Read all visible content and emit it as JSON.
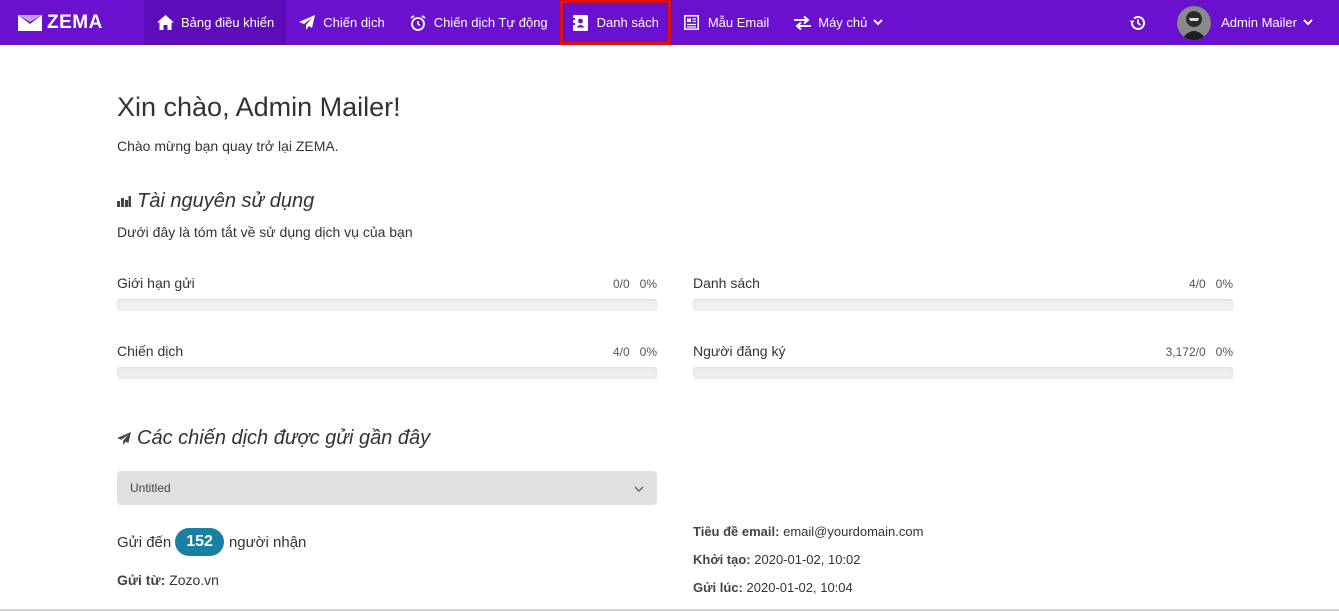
{
  "brand": {
    "name": "ZEMA"
  },
  "nav": {
    "items": [
      {
        "label": "Bảng điều khiển",
        "icon": "home-icon"
      },
      {
        "label": "Chiến dịch",
        "icon": "paper-plane-icon"
      },
      {
        "label": "Chiến dịch Tự động",
        "icon": "alarm-clock-icon"
      },
      {
        "label": "Danh sách",
        "icon": "address-book-icon"
      },
      {
        "label": "Mẫu Email",
        "icon": "newspaper-icon"
      },
      {
        "label": "Máy chủ",
        "icon": "exchange-icon"
      }
    ],
    "active_index": 0,
    "highlighted_index": 3
  },
  "user": {
    "name": "Admin Mailer"
  },
  "greeting": {
    "title": "Xin chào, Admin Mailer!",
    "subtitle": "Chào mừng bạn quay trở lại ZEMA."
  },
  "resources": {
    "heading": "Tài nguyên sử dụng",
    "subheading": "Dưới đây là tóm tắt về sử dụng dịch vụ của bạn",
    "items": [
      {
        "label": "Giới hạn gửi",
        "count": "0/0",
        "percent": "0%",
        "fill": 0
      },
      {
        "label": "Danh sách",
        "count": "4/0",
        "percent": "0%",
        "fill": 0
      },
      {
        "label": "Chiến dịch",
        "count": "4/0",
        "percent": "0%",
        "fill": 0
      },
      {
        "label": "Người đăng ký",
        "count": "3,172/0",
        "percent": "0%",
        "fill": 0
      }
    ]
  },
  "recent": {
    "heading": "Các chiến dịch được gửi gần đây",
    "selected_campaign": "Untitled",
    "sent_to_prefix": "Gửi đến",
    "recipients": "152",
    "sent_to_suffix": "người nhận",
    "from_label": "Gửi từ:",
    "from_value": "Zozo.vn",
    "subject_label": "Tiêu đề email:",
    "subject_value": "email@yourdomain.com",
    "created_label": "Khởi tạo:",
    "created_value": "2020-01-02, 10:02",
    "sent_label": "Gửi lúc:",
    "sent_value": "2020-01-02, 10:04"
  },
  "colors": {
    "navbar": "#6a10cf",
    "badge": "#1a7fa0",
    "highlight": "#e01010"
  }
}
